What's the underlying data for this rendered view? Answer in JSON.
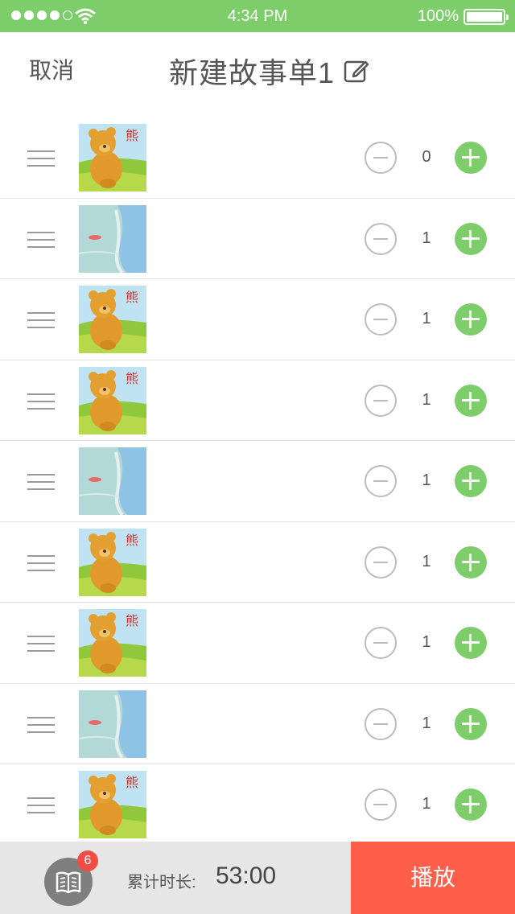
{
  "status_bar": {
    "time": "4:34 PM",
    "battery": "100%",
    "signal_dots": 5,
    "signal_filled": 4
  },
  "nav": {
    "cancel_label": "取消",
    "title": "新建故事单1",
    "edit_icon": "edit-icon"
  },
  "items": [
    {
      "thumb": "bear",
      "count": "0"
    },
    {
      "thumb": "lake",
      "count": "1"
    },
    {
      "thumb": "bear",
      "count": "1"
    },
    {
      "thumb": "bear",
      "count": "1"
    },
    {
      "thumb": "lake",
      "count": "1"
    },
    {
      "thumb": "bear",
      "count": "1"
    },
    {
      "thumb": "bear",
      "count": "1"
    },
    {
      "thumb": "lake",
      "count": "1"
    },
    {
      "thumb": "bear",
      "count": "1"
    }
  ],
  "bottom": {
    "badge": "6",
    "duration_label": "累计时长:",
    "duration_value": "53:00",
    "play_label": "播放"
  },
  "colors": {
    "accent": "#7dcd6a",
    "play": "#ff5e4a",
    "badge": "#f04e45"
  }
}
